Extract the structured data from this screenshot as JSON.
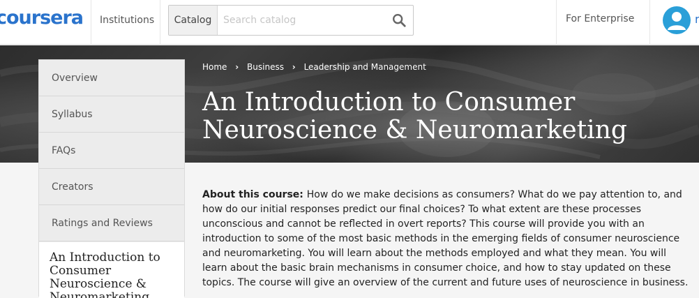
{
  "header": {
    "logo_text": "coursera",
    "institutions_label": "Institutions",
    "catalog_label": "Catalog",
    "search_placeholder": "Search catalog",
    "enterprise_label": "For Enterprise",
    "user_initial": "r",
    "brand_color": "#2a73cc"
  },
  "hero": {
    "breadcrumb": [
      "Home",
      "Business",
      "Leadership and Management"
    ],
    "title": "An Introduction to Consumer Neuroscience & Neuromarketing"
  },
  "sidenav": {
    "items": [
      "Overview",
      "Syllabus",
      "FAQs",
      "Creators",
      "Ratings and Reviews"
    ],
    "course_title": "An Introduction to Consumer Neuroscience & Neuromarketing"
  },
  "about": {
    "label": "About this course:",
    "text": "How do we make decisions as consumers? What do we pay attention to, and how do our initial responses predict our final choices? To what extent are these processes unconscious and cannot be reflected in overt reports? This course will provide you with an introduction to some of the most basic methods in the emerging fields of consumer neuroscience and neuromarketing. You will learn about the methods employed and what they mean. You will learn about the basic brain mechanisms in consumer choice, and how to stay updated on these topics. The course will give an overview of the current and future uses of neuroscience in business."
  }
}
